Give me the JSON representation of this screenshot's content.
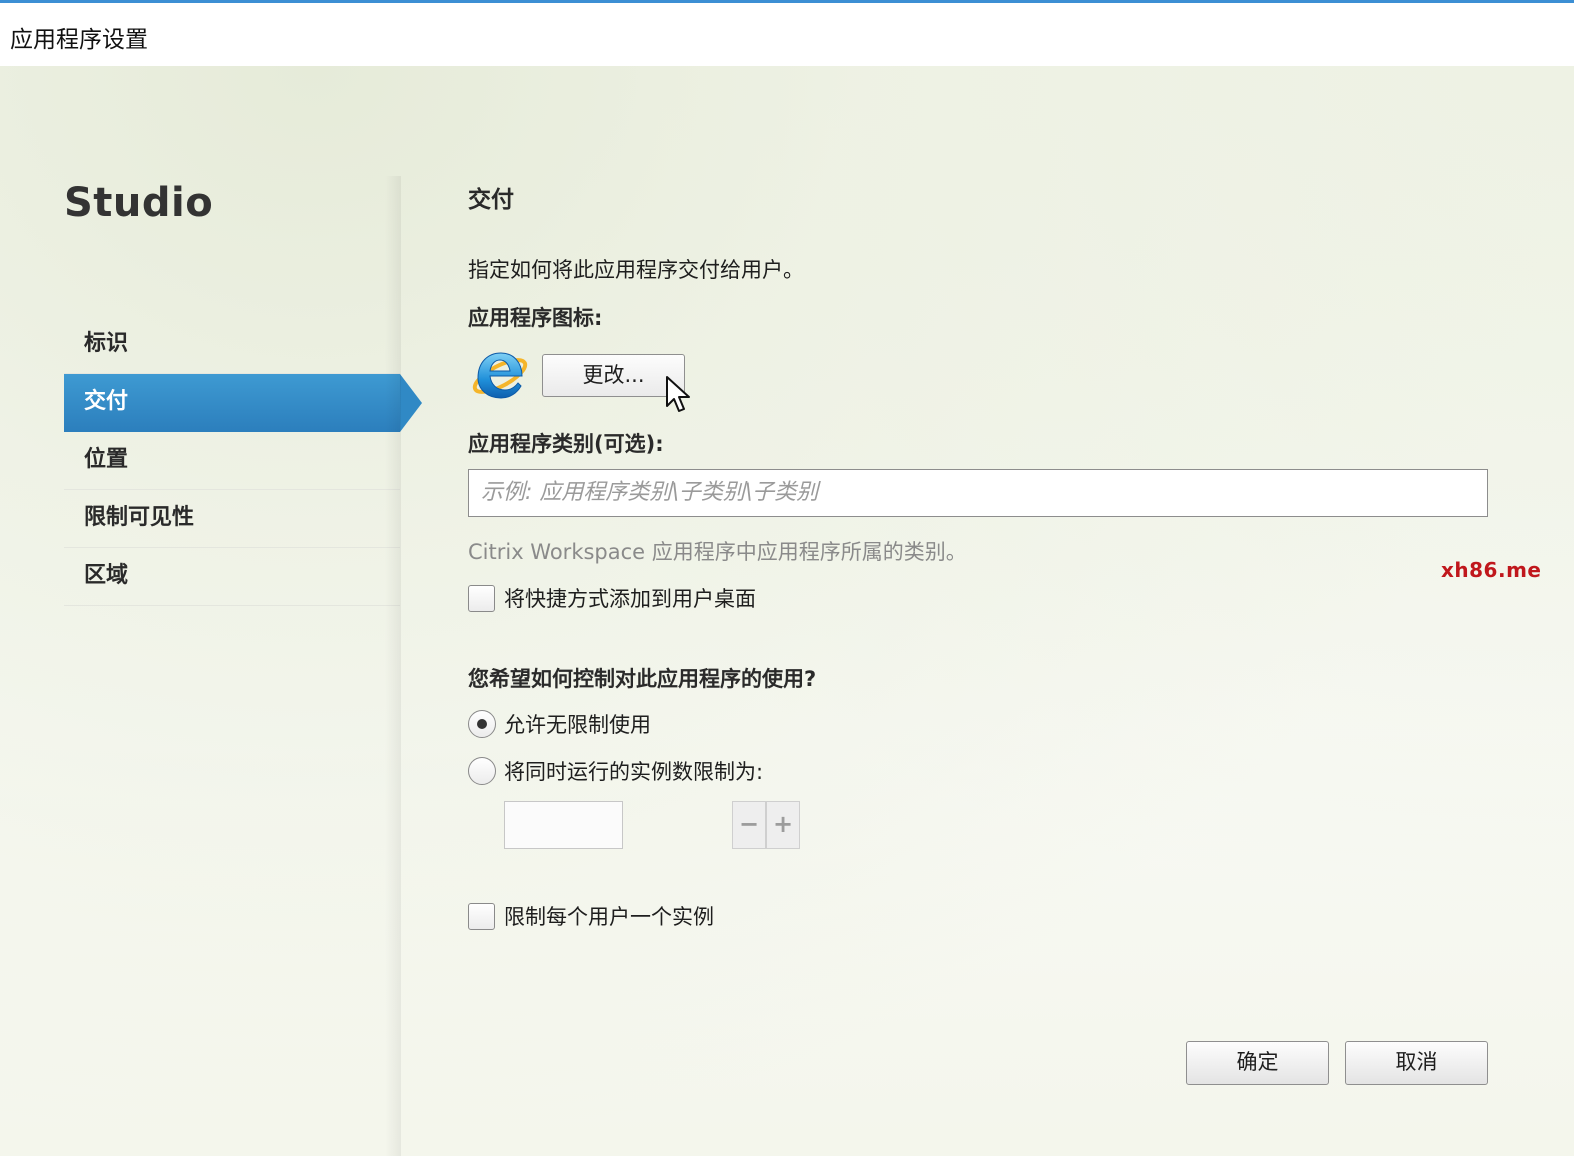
{
  "window": {
    "title": "应用程序设置"
  },
  "sidebar": {
    "brand": "Studio",
    "items": [
      {
        "label": "标识",
        "active": false
      },
      {
        "label": "交付",
        "active": true
      },
      {
        "label": "位置",
        "active": false
      },
      {
        "label": "限制可见性",
        "active": false
      },
      {
        "label": "区域",
        "active": false
      }
    ]
  },
  "main": {
    "section_title": "交付",
    "description": "指定如何将此应用程序交付给用户。",
    "icon_label": "应用程序图标:",
    "app_icon": "internet-explorer-icon",
    "change_button": "更改...",
    "category_label": "应用程序类别(可选):",
    "category_value": "",
    "category_placeholder": "示例: 应用程序类别\\子类别\\子类别",
    "category_hint": "Citrix Workspace 应用程序中应用程序所属的类别。",
    "shortcut_checkbox": {
      "label": "将快捷方式添加到用户桌面",
      "checked": false
    },
    "usage_question": "您希望如何控制对此应用程序的使用?",
    "usage_options": [
      {
        "label": "允许无限制使用",
        "selected": true
      },
      {
        "label": "将同时运行的实例数限制为:",
        "selected": false
      }
    ],
    "instance_limit": {
      "value": "",
      "minus": "−",
      "plus": "+"
    },
    "one_instance_checkbox": {
      "label": "限制每个用户一个实例",
      "checked": false
    }
  },
  "footer": {
    "ok": "确定",
    "cancel": "取消"
  },
  "watermark": "xh86.me",
  "colors": {
    "accent": "#2c7fbd",
    "title_border": "#3c8fd4",
    "watermark": "#c0171c"
  }
}
